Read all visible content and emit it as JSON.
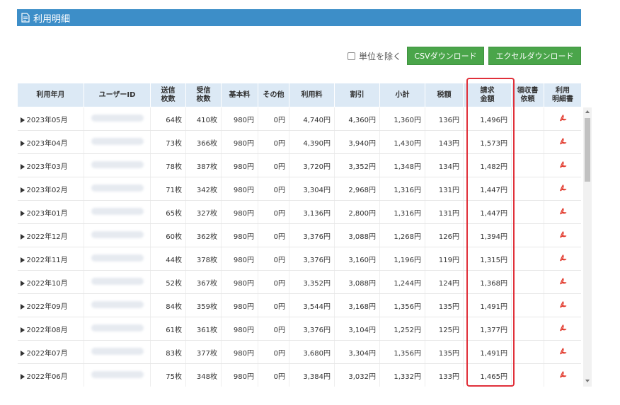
{
  "title": "利用明細",
  "toolbar": {
    "exclude_label": "単位を除く",
    "csv_label": "CSVダウンロード",
    "excel_label": "エクセルダウンロード"
  },
  "colors": {
    "title_bar": "#3d8ec8",
    "header_bg": "#dce9f5",
    "button_green": "#4aa54a",
    "highlight_red": "#e0303a",
    "pdf_red": "#e23b2e"
  },
  "columns": [
    [
      "利用年月"
    ],
    [
      "ユーザーID"
    ],
    [
      "送信",
      "枚数"
    ],
    [
      "受信",
      "枚数"
    ],
    [
      "基本料"
    ],
    [
      "その他"
    ],
    [
      "利用料"
    ],
    [
      "割引"
    ],
    [
      "小計"
    ],
    [
      "税額"
    ],
    [
      "請求",
      "金額"
    ],
    [
      "領収書",
      "依頼"
    ],
    [
      "利用",
      "明細書"
    ]
  ],
  "rows": [
    {
      "month": "2023年05月",
      "sent": "64枚",
      "recv": "410枚",
      "basic": "980円",
      "other": "0円",
      "usage": "4,740円",
      "discount": "4,360円",
      "subtotal": "1,360円",
      "tax": "136円",
      "total": "1,496円"
    },
    {
      "month": "2023年04月",
      "sent": "73枚",
      "recv": "366枚",
      "basic": "980円",
      "other": "0円",
      "usage": "4,390円",
      "discount": "3,940円",
      "subtotal": "1,430円",
      "tax": "143円",
      "total": "1,573円"
    },
    {
      "month": "2023年03月",
      "sent": "78枚",
      "recv": "387枚",
      "basic": "980円",
      "other": "0円",
      "usage": "3,720円",
      "discount": "3,352円",
      "subtotal": "1,348円",
      "tax": "134円",
      "total": "1,482円"
    },
    {
      "month": "2023年02月",
      "sent": "71枚",
      "recv": "342枚",
      "basic": "980円",
      "other": "0円",
      "usage": "3,304円",
      "discount": "2,968円",
      "subtotal": "1,316円",
      "tax": "131円",
      "total": "1,447円"
    },
    {
      "month": "2023年01月",
      "sent": "65枚",
      "recv": "327枚",
      "basic": "980円",
      "other": "0円",
      "usage": "3,136円",
      "discount": "2,800円",
      "subtotal": "1,316円",
      "tax": "131円",
      "total": "1,447円"
    },
    {
      "month": "2022年12月",
      "sent": "60枚",
      "recv": "362枚",
      "basic": "980円",
      "other": "0円",
      "usage": "3,376円",
      "discount": "3,088円",
      "subtotal": "1,268円",
      "tax": "126円",
      "total": "1,394円"
    },
    {
      "month": "2022年11月",
      "sent": "44枚",
      "recv": "378枚",
      "basic": "980円",
      "other": "0円",
      "usage": "3,376円",
      "discount": "3,160円",
      "subtotal": "1,196円",
      "tax": "119円",
      "total": "1,315円"
    },
    {
      "month": "2022年10月",
      "sent": "52枚",
      "recv": "367枚",
      "basic": "980円",
      "other": "0円",
      "usage": "3,352円",
      "discount": "3,088円",
      "subtotal": "1,244円",
      "tax": "124円",
      "total": "1,368円"
    },
    {
      "month": "2022年09月",
      "sent": "84枚",
      "recv": "359枚",
      "basic": "980円",
      "other": "0円",
      "usage": "3,544円",
      "discount": "3,168円",
      "subtotal": "1,356円",
      "tax": "135円",
      "total": "1,491円"
    },
    {
      "month": "2022年08月",
      "sent": "61枚",
      "recv": "361枚",
      "basic": "980円",
      "other": "0円",
      "usage": "3,376円",
      "discount": "3,104円",
      "subtotal": "1,252円",
      "tax": "125円",
      "total": "1,377円"
    },
    {
      "month": "2022年07月",
      "sent": "83枚",
      "recv": "377枚",
      "basic": "980円",
      "other": "0円",
      "usage": "3,680円",
      "discount": "3,304円",
      "subtotal": "1,356円",
      "tax": "135円",
      "total": "1,491円"
    },
    {
      "month": "2022年06月",
      "sent": "75枚",
      "recv": "348枚",
      "basic": "980円",
      "other": "0円",
      "usage": "3,384円",
      "discount": "3,032円",
      "subtotal": "1,332円",
      "tax": "133円",
      "total": "1,465円"
    }
  ]
}
